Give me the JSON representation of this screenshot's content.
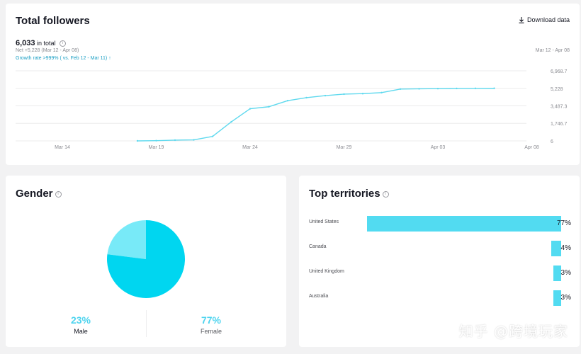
{
  "followers_card": {
    "title": "Total followers",
    "download_label": "Download data",
    "total_value": "6,033",
    "total_suffix": "in total",
    "net_text": "Net +5,228 (Mar 12 - Apr 08)",
    "growth_text": "Growth rate >999% ( vs. Feb 12 - Mar 11)",
    "range_label": "Mar 12 - Apr 08"
  },
  "gender_card": {
    "title": "Gender",
    "male_pct": "23%",
    "male_label": "Male",
    "female_pct": "77%",
    "female_label": "Female"
  },
  "territories_card": {
    "title": "Top territories",
    "rows": [
      {
        "name": "United States",
        "pct": "77%",
        "value": 77
      },
      {
        "name": "Canada",
        "pct": "4%",
        "value": 4
      },
      {
        "name": "United Kingdom",
        "pct": "3%",
        "value": 3
      },
      {
        "name": "Australia",
        "pct": "3%",
        "value": 3
      }
    ]
  },
  "watermark": "知乎 @跨境玩家",
  "colors": {
    "accent": "#4fd4ef",
    "line": "#5fd9ee",
    "male_slice": "#78eaf8",
    "female_slice": "#00d6f0",
    "bar": "#52dbf1",
    "growth_text": "#1a9fc4"
  },
  "chart_data": [
    {
      "type": "line",
      "title": "Total followers",
      "x_ticks": [
        "Mar 14",
        "Mar 19",
        "Mar 24",
        "Mar 29",
        "Apr 03",
        "Apr 08"
      ],
      "y_ticks": [
        "6",
        "1,746.7",
        "3,487.3",
        "5,228",
        "6,968.7"
      ],
      "y_tick_values": [
        6,
        1746.7,
        3487.3,
        5228,
        6968.7
      ],
      "ylim": [
        6,
        6968.7
      ],
      "x_range": [
        "Mar 12",
        "Apr 08"
      ],
      "grid": true,
      "series": [
        {
          "x": [
            "Mar 18",
            "Mar 19",
            "Mar 20",
            "Mar 21",
            "Mar 22",
            "Mar 23",
            "Mar 24",
            "Mar 25",
            "Mar 26",
            "Mar 27",
            "Mar 28",
            "Mar 29",
            "Mar 30",
            "Mar 31",
            "Apr 01",
            "Apr 02",
            "Apr 03",
            "Apr 04",
            "Apr 05",
            "Apr 06"
          ],
          "y": [
            6,
            30,
            80,
            110,
            450,
            1900,
            3200,
            3400,
            4000,
            4300,
            4500,
            4650,
            4700,
            4800,
            5150,
            5180,
            5200,
            5215,
            5222,
            5228
          ]
        }
      ]
    },
    {
      "type": "pie",
      "title": "Gender",
      "categories": [
        "Male",
        "Female"
      ],
      "values": [
        23,
        77
      ]
    },
    {
      "type": "bar",
      "title": "Top territories",
      "orientation": "horizontal",
      "categories": [
        "United States",
        "Canada",
        "United Kingdom",
        "Australia"
      ],
      "values": [
        77,
        4,
        3,
        3
      ],
      "unit": "%"
    }
  ]
}
